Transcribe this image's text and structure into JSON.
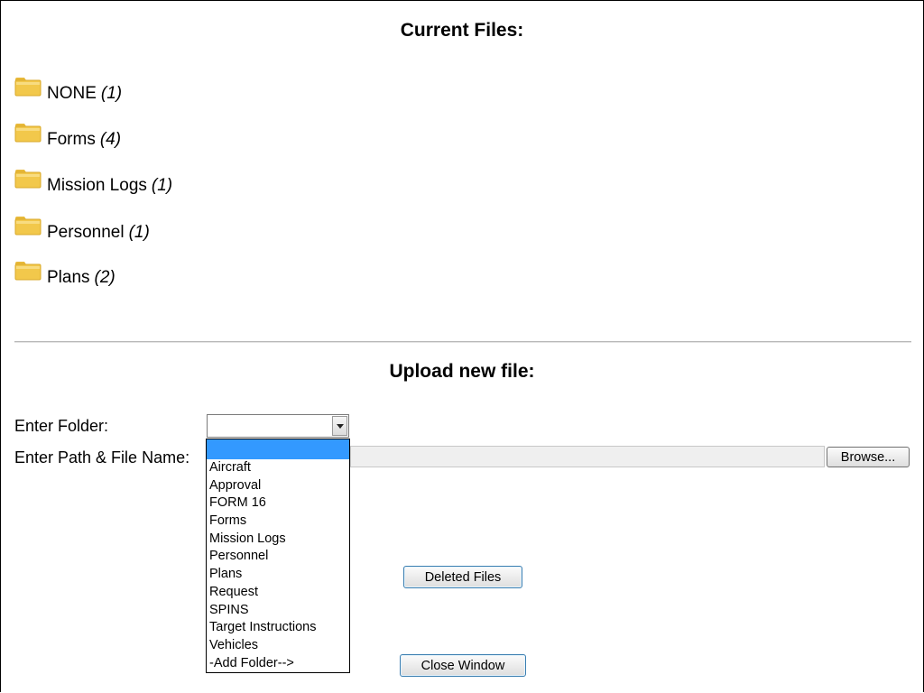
{
  "current_files": {
    "title": "Current Files:",
    "folders": [
      {
        "name": "NONE",
        "count": "(1)"
      },
      {
        "name": "Forms",
        "count": "(4)"
      },
      {
        "name": "Mission Logs",
        "count": "(1)"
      },
      {
        "name": "Personnel",
        "count": "(1)"
      },
      {
        "name": "Plans",
        "count": "(2)"
      }
    ]
  },
  "upload": {
    "title": "Upload new file:",
    "folder_label": "Enter Folder:",
    "path_label": "Enter Path & File Name:",
    "folder_select_value": "",
    "folder_options": [
      "",
      "Aircraft",
      "Approval",
      "FORM 16",
      "Forms",
      "Mission Logs",
      "Personnel",
      "Plans",
      "Request",
      "SPINS",
      "Target Instructions",
      "Vehicles",
      "-Add Folder-->"
    ],
    "file_path_value": "",
    "browse_label": "Browse...",
    "deleted_files_label": "Deleted Files",
    "close_window_label": "Close Window"
  },
  "colors": {
    "folder_icon": "#f2c84b",
    "selected_option": "#3399ff",
    "button_border": "#3c7fb1"
  }
}
